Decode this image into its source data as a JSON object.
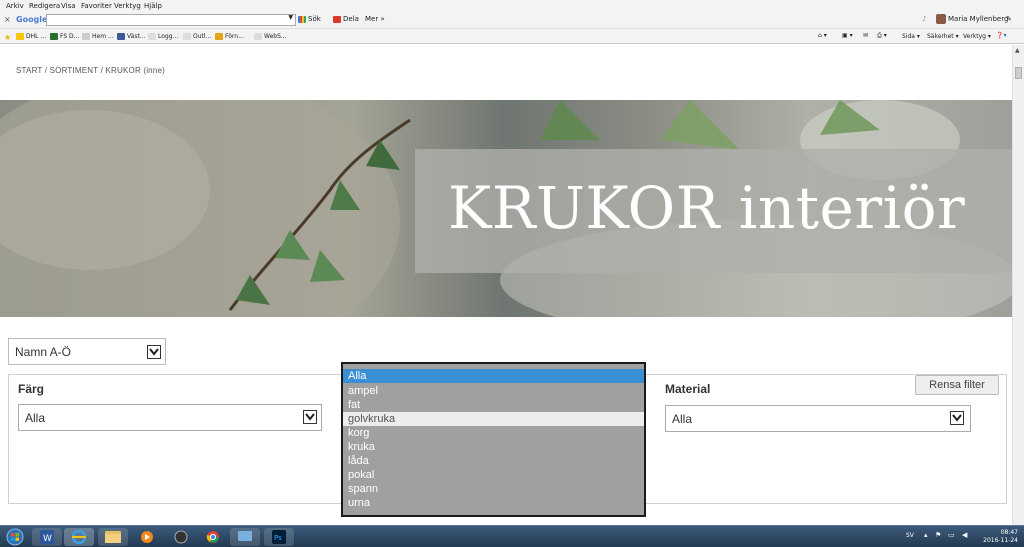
{
  "browser": {
    "menu": [
      "Arkiv",
      "Redigera",
      "Visa",
      "Favoriter",
      "Verktyg",
      "Hjälp"
    ],
    "google": {
      "logo": "Google",
      "search_label": "Sök",
      "share_label": "Dela",
      "more_label": "Mer »",
      "user_name": "Maria Myllenberg"
    },
    "favorites": [
      "DHL ...",
      "FS D...",
      "Hem ...",
      "Väst...",
      "Logg...",
      "Outl...",
      "Förn...",
      "WebS..."
    ],
    "command_bar": {
      "page": "Sida",
      "safety": "Säkerhet",
      "tools": "Verktyg"
    }
  },
  "page": {
    "breadcrumb": "START / SORTIMENT / KRUKOR (inne)",
    "hero_title": "KRUKOR interiör",
    "sort": {
      "value": "Namn A-Ö"
    },
    "filters": {
      "color_label": "Färg",
      "color_value": "Alla",
      "material_label": "Material",
      "material_value": "Alla",
      "clear_label": "Rensa filter"
    },
    "type_dropdown": {
      "options": [
        "Alla",
        "ampel",
        "fat",
        "golvkruka",
        "korg",
        "kruka",
        "låda",
        "pokal",
        "spann",
        "urna"
      ],
      "selected_index": 0,
      "hover_index": 3
    }
  },
  "taskbar": {
    "language": "SV",
    "time": "08:47",
    "date": "2016-11-24"
  },
  "colors": {
    "dropdown_bg": "#a0a0a0",
    "dropdown_selected": "#3a8fd4",
    "taskbar": "#233a52"
  }
}
